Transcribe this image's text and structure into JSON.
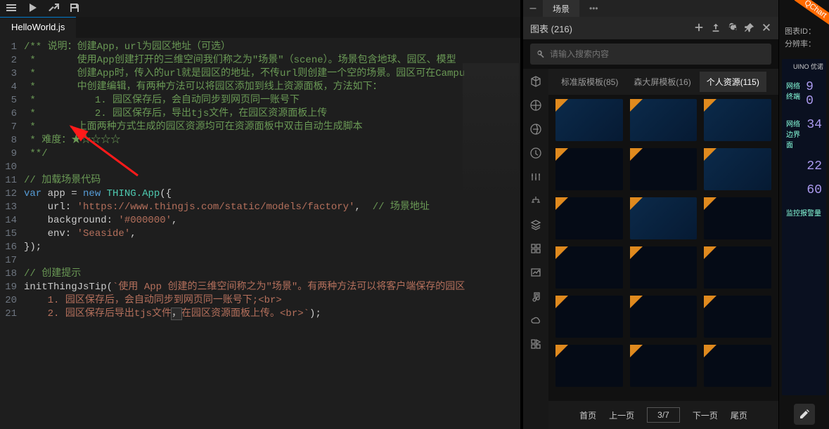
{
  "editor": {
    "tab": "HelloWorld.js",
    "lines": [
      {
        "n": 1,
        "cls": "c-com",
        "t": "/** 说明：创建App，url为园区地址（可选）"
      },
      {
        "n": 2,
        "cls": "c-com",
        "t": " *       使用App创建打开的三维空间我们称之为\"场景\"（scene）。场景包含地球、园区、模型"
      },
      {
        "n": 3,
        "cls": "c-com",
        "t": " *       创建App时，传入的url就是园区的地址，不传url则创建一个空的场景。园区可在Campu"
      },
      {
        "n": 4,
        "cls": "c-com",
        "t": " *       中创建编辑，有两种方法可以将园区添加到线上资源面板，方法如下："
      },
      {
        "n": 5,
        "cls": "c-com",
        "t": " *          1. 园区保存后，会自动同步到网页同一账号下"
      },
      {
        "n": 6,
        "cls": "c-com",
        "t": " *          2. 园区保存后，导出tjs文件，在园区资源面板上传"
      },
      {
        "n": 7,
        "cls": "c-com",
        "t": " *       上面两种方式生成的园区资源均可在资源面板中双击自动生成脚本"
      },
      {
        "n": 8,
        "cls": "c-com",
        "t": " * 难度：★☆☆☆☆"
      },
      {
        "n": 9,
        "cls": "c-com",
        "t": " **/"
      },
      {
        "n": 10,
        "cls": "",
        "t": ""
      },
      {
        "n": 11,
        "cls": "c-com",
        "t": "// 加载场景代码"
      },
      {
        "n": 12,
        "cls": "",
        "t": "<span class='c-key'>var</span> app = <span class='c-key'>new</span> <span class='c-cls'>THING.App</span>({"
      },
      {
        "n": 13,
        "cls": "",
        "t": "    url: <span class='c-str'>'https://www.thingjs.com/static/models/factory'</span>,  <span class='c-com'>// 场景地址</span>"
      },
      {
        "n": 14,
        "cls": "",
        "t": "    background: <span class='c-str'>'#000000'</span>,"
      },
      {
        "n": 15,
        "cls": "",
        "t": "    env: <span class='c-str'>'Seaside'</span>,"
      },
      {
        "n": 16,
        "cls": "",
        "t": "});"
      },
      {
        "n": 17,
        "cls": "",
        "t": ""
      },
      {
        "n": 18,
        "cls": "c-com",
        "t": "// 创建提示"
      },
      {
        "n": 19,
        "cls": "",
        "t": "initThingJsTip(<span class='c-str'>`使用 App 创建的三维空间称之为\"场景\"。有两种方法可以将客户端保存的园区</span>"
      },
      {
        "n": 20,
        "cls": "",
        "t": "    <span class='c-str'>1. 园区保存后，会自动同步到网页同一账号下;&lt;br&gt;</span>"
      },
      {
        "n": 21,
        "cls": "",
        "t": "    <span class='c-str'>2. 园区保存后导出tjs文件</span><span class='caret-line'>，</span><span class='c-str'>在园区资源面板上传。&lt;br&gt;`</span>);"
      }
    ]
  },
  "panel": {
    "toptab": "场景",
    "title_prefix": "图表",
    "count": "(216)",
    "search_ph": "请输入搜索内容",
    "subtabs": [
      {
        "label": "标准版模板(85)",
        "active": false
      },
      {
        "label": "森大屏模板(16)",
        "active": false
      },
      {
        "label": "个人资源(115)",
        "active": true
      }
    ],
    "rail_icons": [
      "cube",
      "globe",
      "earth",
      "clock",
      "sliders",
      "tree",
      "layers",
      "grid",
      "image",
      "music",
      "cloud",
      "widget"
    ],
    "thumbs": [
      false,
      false,
      false,
      true,
      true,
      false,
      true,
      false,
      true,
      true,
      true,
      true,
      true,
      true,
      true,
      true,
      true,
      true
    ],
    "pager": {
      "first": "首页",
      "prev": "上一页",
      "page": "3/7",
      "next": "下一页",
      "last": "尾页"
    }
  },
  "qchart": {
    "badge": "QChart",
    "id_label": "图表ID：",
    "res_label": "分辨率：",
    "brand": "UINO 优诺",
    "rows": [
      {
        "l": "网络终端",
        "v": "9 0"
      },
      {
        "l": "网络边界面",
        "v": "34"
      },
      {
        "l": "",
        "v": "22"
      },
      {
        "l": "",
        "v": "60"
      },
      {
        "l": "监控报警量",
        "v": ""
      }
    ]
  }
}
